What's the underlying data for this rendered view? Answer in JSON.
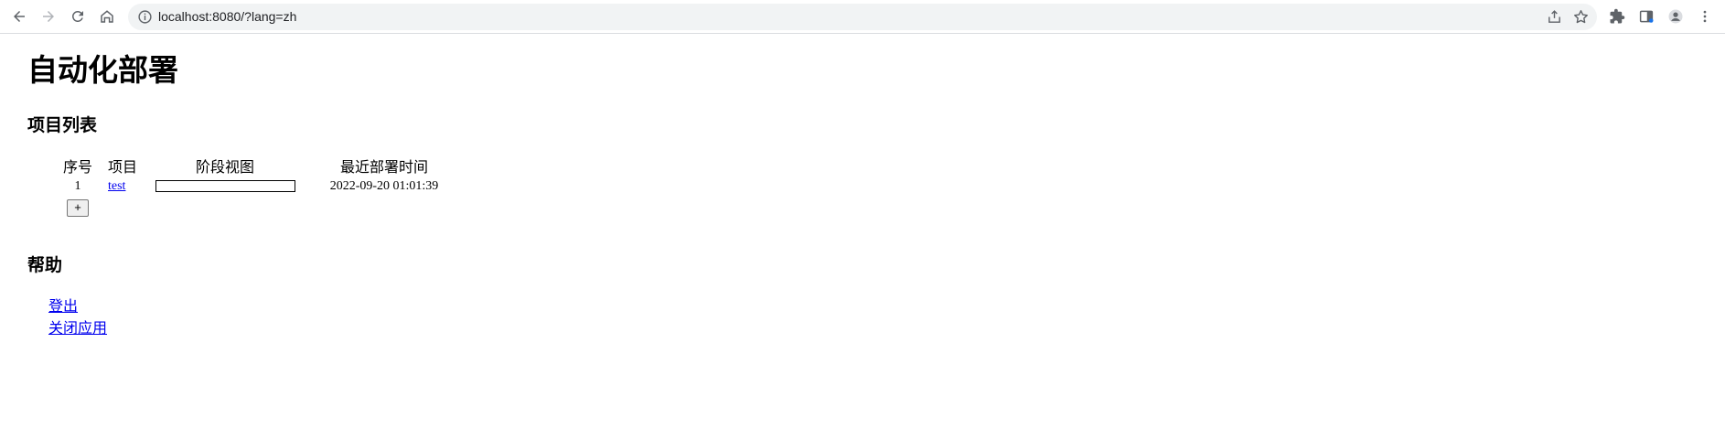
{
  "browser": {
    "url": "localhost:8080/?lang=zh",
    "icons": [
      "back-icon",
      "forward-icon",
      "reload-icon",
      "home-icon",
      "info-icon",
      "share-icon",
      "star-icon",
      "extensions-icon",
      "sidebar-icon",
      "profile-icon",
      "menu-icon"
    ]
  },
  "page": {
    "title": "自动化部署",
    "projects": {
      "heading": "项目列表",
      "columns": [
        "序号",
        "项目",
        "阶段视图",
        "最近部署时间"
      ],
      "rows": [
        {
          "num": "1",
          "project": "test",
          "stage_progress": 0,
          "last_deploy": "2022-09-20 01:01:39"
        }
      ],
      "add_label": "+"
    },
    "help": {
      "heading": "帮助",
      "links": [
        "登出",
        "关闭应用"
      ]
    }
  }
}
